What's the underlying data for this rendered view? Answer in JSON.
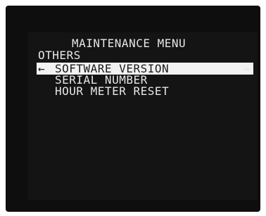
{
  "menu": {
    "title": "MAINTENANCE MENU",
    "section": "OTHERS",
    "items": [
      {
        "label": "SOFTWARE VERSION",
        "selected": true
      },
      {
        "label": "SERIAL NUMBER",
        "selected": false
      },
      {
        "label": "HOUR METER RESET",
        "selected": false
      }
    ],
    "left_arrow": "←",
    "right_arrow": "→"
  }
}
